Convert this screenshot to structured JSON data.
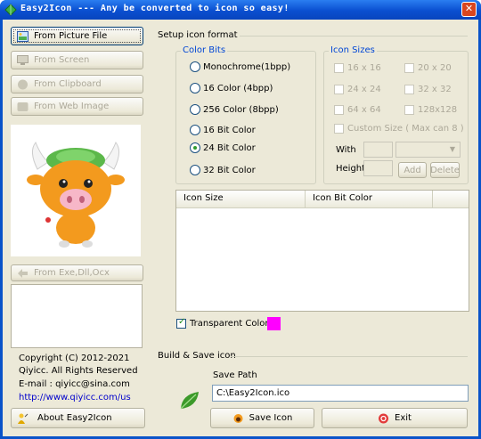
{
  "window": {
    "title": "Easy2Icon --- Any be converted to icon so easy!",
    "close": "✕"
  },
  "source_buttons": {
    "picture_file": "From Picture File",
    "screen": "From Screen",
    "clipboard": "From Clipboard",
    "web_image": "From Web Image",
    "exe": "From Exe,Dll,Ocx"
  },
  "info": {
    "copyright": "Copyright (C) 2012-2021",
    "company": "Qiyicc. All Rights Reserved",
    "email": "E-mail : qiyicc@sina.com",
    "url": "http://www.qiyicc.com/us",
    "about": "About Easy2Icon"
  },
  "setup": {
    "title": "Setup icon format",
    "color_bits": {
      "title": "Color Bits",
      "options": [
        "Monochrome(1bpp)",
        "16 Color (4bpp)",
        "256 Color (8bpp)",
        "16 Bit Color",
        "24 Bit Color",
        "32 Bit Color"
      ],
      "selected": "24 Bit Color"
    },
    "icon_sizes": {
      "title": "Icon Sizes",
      "sizes": [
        "16 x 16",
        "20 x 20",
        "24 x 24",
        "32 x 32",
        "64 x 64",
        "128x128"
      ],
      "custom": "Custom Size ( Max can 8 )",
      "width_label": "With",
      "height_label": "Height",
      "add": "Add",
      "delete": "Delete"
    }
  },
  "table": {
    "columns": [
      "Icon Size",
      "Icon Bit Color"
    ]
  },
  "transparent": {
    "label": "Transparent Color",
    "color": "#ff00ff",
    "checked": true
  },
  "build": {
    "title": "Build & Save icon",
    "save_path_label": "Save Path",
    "save_path": "C:\\Easy2Icon.ico",
    "save": "Save Icon",
    "exit": "Exit"
  },
  "colors": {
    "titlebar": "#0a53c9",
    "link": "#0000cc",
    "group_title": "#0046d5"
  }
}
